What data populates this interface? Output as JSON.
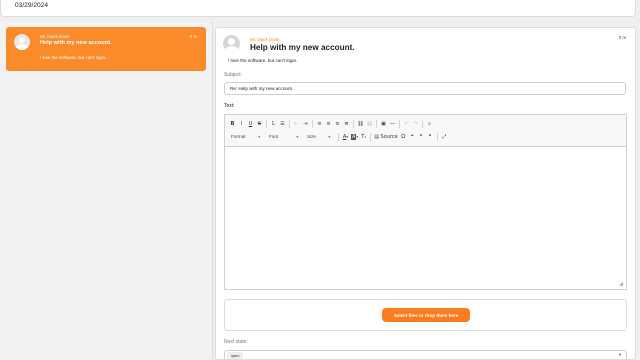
{
  "header": {
    "date": "03/29/2024"
  },
  "ticket_list": [
    {
      "author": "Mr. blank blank",
      "subject": "Help with my new account.",
      "snippet": "I love the software, but can't login...",
      "age": "0 m"
    }
  ],
  "message": {
    "author": "Mr. blank blank",
    "subject": "Help with my new account.",
    "body": "I love the software, but can't login.",
    "age": "0 m"
  },
  "reply": {
    "subject_label": "Subject:",
    "subject_value": "Re: Help with my new account.",
    "text_label": "Text:",
    "upload_label": "Select files or drop them here",
    "next_state_label": "Next state:",
    "next_state_value": "open"
  },
  "editor_toolbar": {
    "format_label": "Format",
    "font_label": "Font",
    "size_label": "Size",
    "source_label": "Source",
    "icons": [
      "bold-icon",
      "italic-icon",
      "underline-icon",
      "strikethrough-icon",
      "numbered-list-icon",
      "bulleted-list-icon",
      "outdent-icon",
      "indent-icon",
      "align-left-icon",
      "align-center-icon",
      "align-right-icon",
      "justify-icon",
      "link-icon",
      "unlink-icon",
      "image-icon",
      "horizontal-line-icon",
      "undo-icon",
      "redo-icon",
      "find-icon",
      "text-color-icon",
      "background-color-icon",
      "remove-format-icon",
      "source-icon",
      "special-char-icon",
      "blockquote-icon",
      "quote-icon",
      "maximize-icon"
    ]
  },
  "colors": {
    "accent": "#fb8a2a",
    "button": "#fb7d1f"
  }
}
